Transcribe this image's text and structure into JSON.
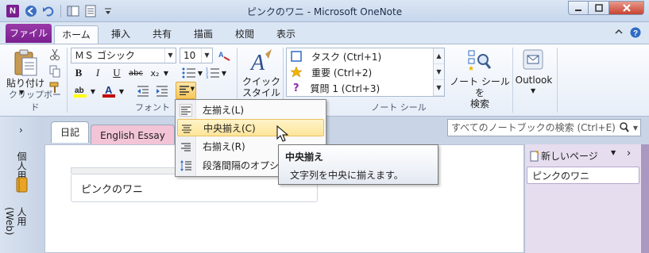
{
  "window": {
    "title": "ピンクのワニ - Microsoft OneNote",
    "app_icon": "N"
  },
  "quick_access": [
    "back-icon",
    "undo-icon",
    "dock-icon",
    "page-view-icon",
    "customize-icon"
  ],
  "ribbon": {
    "file_tab": "ファイル",
    "tabs": [
      "ホーム",
      "挿入",
      "共有",
      "描画",
      "校閲",
      "表示"
    ],
    "active_tab": "ホーム",
    "clipboard": {
      "paste_label": "貼り付け",
      "group_label": "クリップボード"
    },
    "font": {
      "font_name": "ＭＳ ゴシック",
      "font_size": "10",
      "bold": "B",
      "italic": "I",
      "underline": "U",
      "strike": "abc",
      "sub": "x₂",
      "group_label": "フォント"
    },
    "styles": {
      "label_line1": "クイック",
      "label_line2": "スタイル"
    },
    "tags": {
      "items": [
        "タスク (Ctrl+1)",
        "重要 (Ctrl+2)",
        "質問 1 (Ctrl+3)"
      ],
      "find_line1": "ノート シールを",
      "find_line2": "検索",
      "group_label": "ノート シール"
    },
    "outlook": {
      "label": "Outlook"
    }
  },
  "notebook": {
    "side_labels": [
      "個人用",
      "人用 (Web)"
    ],
    "section_tabs": [
      "日記",
      "English Essay"
    ],
    "search_placeholder": "すべてのノートブックの検索 (Ctrl+E)",
    "new_page": "新しいページ",
    "pages": [
      "ピンクのワニ"
    ],
    "page_title": "ピンクのワニ"
  },
  "align_menu": {
    "items": [
      "左揃え(L)",
      "中央揃え(C)",
      "右揃え(R)",
      "段落間隔のオプション"
    ],
    "hovered_index": 1
  },
  "tooltip": {
    "title": "中央揃え",
    "body": "文字列を中央に揃えます。"
  },
  "colors": {
    "file_tab": "#7a1f8f",
    "highlight": "#ffff00",
    "font_color": "#c00000",
    "hover": "#fde59a",
    "page_pane": "#e6ddee",
    "tab_pink": "#f2c4d6"
  }
}
